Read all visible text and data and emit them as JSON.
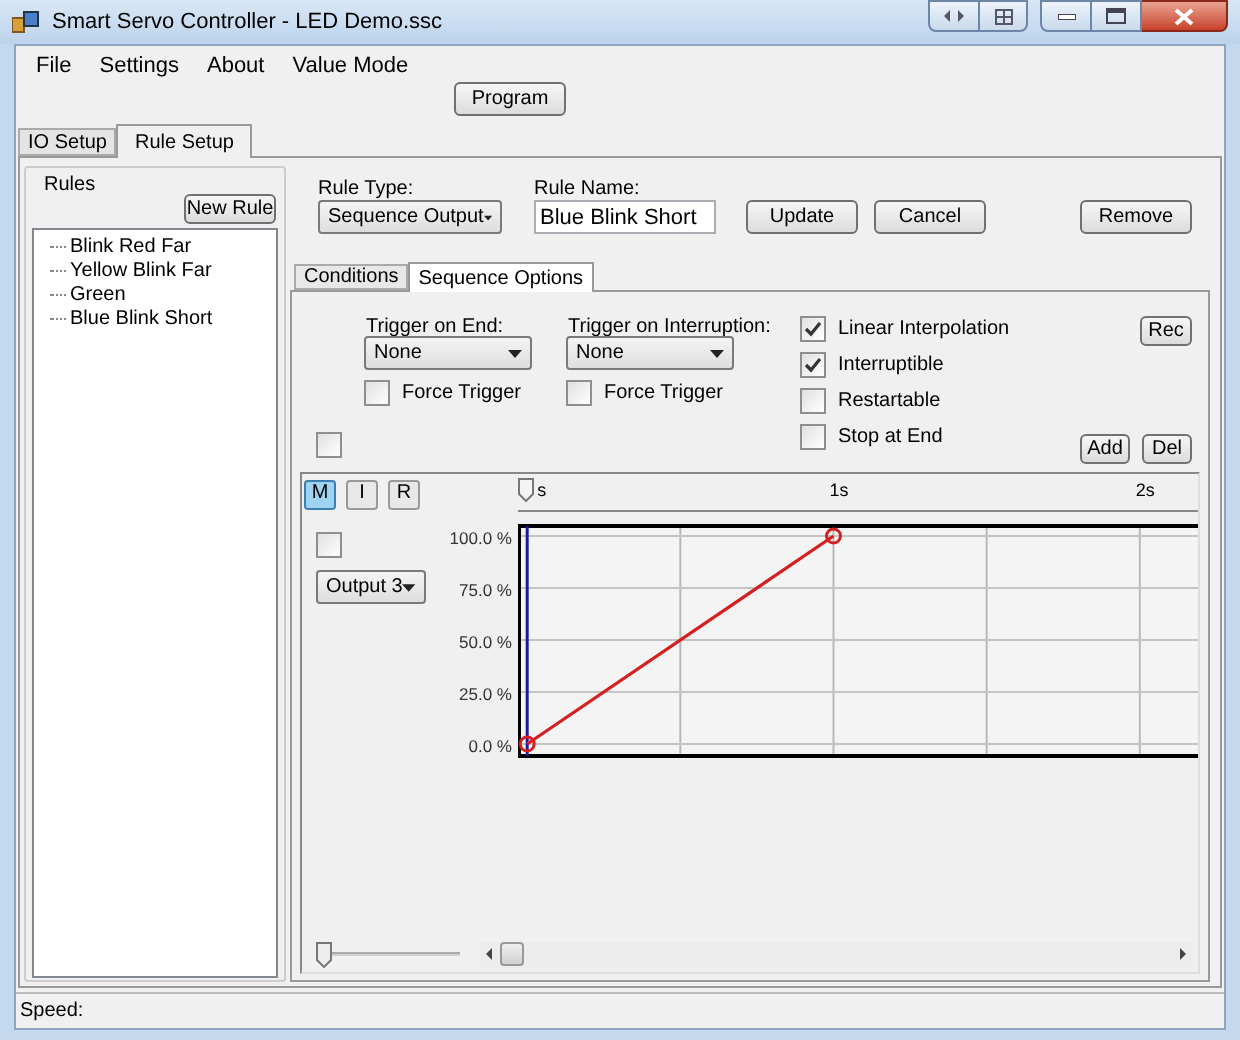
{
  "window": {
    "title": "Smart Servo Controller - LED Demo.ssc"
  },
  "menu": [
    "File",
    "Settings",
    "About",
    "Value Mode"
  ],
  "program_button": "Program",
  "tabs": [
    {
      "label": "IO Setup",
      "selected": false
    },
    {
      "label": "Rule Setup",
      "selected": true
    }
  ],
  "rules": {
    "title": "Rules",
    "new_button": "New Rule",
    "items": [
      "Blink Red Far",
      "Yellow Blink Far",
      "Green",
      "Blue Blink Short"
    ]
  },
  "rule_type": {
    "label": "Rule Type:",
    "value": "Sequence Output"
  },
  "rule_name": {
    "label": "Rule Name:",
    "value": "Blue Blink Short"
  },
  "actions": [
    "Update",
    "Cancel",
    "Remove"
  ],
  "inner_tabs": [
    {
      "label": "Conditions",
      "selected": false
    },
    {
      "label": "Sequence Options",
      "selected": true
    }
  ],
  "triggers": [
    {
      "label": "Trigger on End:",
      "value": "None",
      "force": {
        "label": "Force Trigger",
        "checked": false
      }
    },
    {
      "label": "Trigger on Interruption:",
      "value": "None",
      "force": {
        "label": "Force Trigger",
        "checked": false
      }
    }
  ],
  "options": [
    {
      "label": "Linear Interpolation",
      "checked": true
    },
    {
      "label": "Interruptible",
      "checked": true
    },
    {
      "label": "Restartable",
      "checked": false
    },
    {
      "label": "Stop at End",
      "checked": false
    }
  ],
  "rec_button": "Rec",
  "add_button": "Add",
  "del_button": "Del",
  "master_checkbox": {
    "checked": false
  },
  "timeline": {
    "modes": [
      {
        "label": "M",
        "selected": true
      },
      {
        "label": "I",
        "selected": false
      },
      {
        "label": "R",
        "selected": false
      }
    ],
    "channel": {
      "checked": false
    },
    "speed_slider": {
      "level": 0
    },
    "chart_data": {
      "type": "line",
      "x": [
        0,
        1
      ],
      "grid": true,
      "ref_lines": [
        {
          "axis": "x",
          "value": 0,
          "color": "#1a1aa0"
        }
      ],
      "series": [
        {
          "name": "Output 3",
          "color": "#d42020",
          "marker": "circle",
          "values": [
            0,
            100
          ]
        }
      ],
      "xlim": [
        -0.03,
        2.19
      ],
      "ylim": [
        0,
        100
      ],
      "xticks": [
        {
          "value": 0,
          "label": "s"
        },
        {
          "value": 1,
          "label": "1s"
        },
        {
          "value": 2,
          "label": "2s"
        }
      ],
      "yticks": [
        {
          "value": 0,
          "label": "0.0 %"
        },
        {
          "value": 25,
          "label": "25.0 %"
        },
        {
          "value": 50,
          "label": "50.0 %"
        },
        {
          "value": 75,
          "label": "75.0 %"
        },
        {
          "value": 100,
          "label": "100.0 %"
        }
      ]
    }
  },
  "status_bar": {
    "label": "Speed:"
  }
}
